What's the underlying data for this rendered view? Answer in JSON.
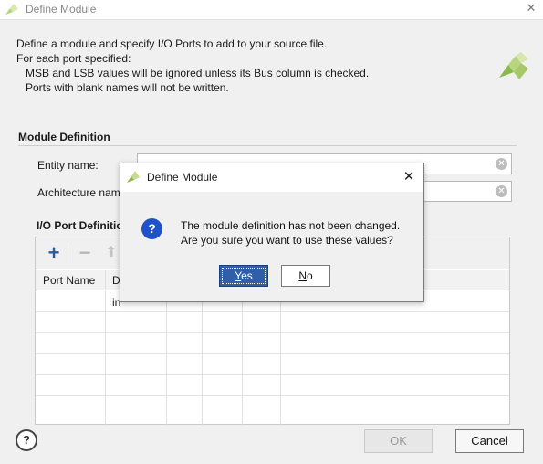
{
  "window": {
    "title": "Define Module",
    "logo_icon": "vivado-logo-icon",
    "close_icon": "close-icon"
  },
  "intro": {
    "line1": "Define a module and specify I/O Ports to add to your source file.",
    "line2": "For each port specified:",
    "line3": "MSB and LSB values will be ignored unless its Bus column is checked.",
    "line4": "Ports with blank names will not be written."
  },
  "module_definition": {
    "section_title": "Module Definition",
    "entity_label": "Entity name:",
    "entity_value": "",
    "architecture_label": "Architecture nam",
    "architecture_value": ""
  },
  "io_ports": {
    "title": "I/O Port Definitio",
    "columns": [
      "Port Name",
      "D"
    ],
    "first_row_direction": "in",
    "toolbar": {
      "add_icon": "plus-icon",
      "remove_icon": "minus-icon",
      "move_up_icon": "arrow-up-icon"
    }
  },
  "footer": {
    "help_label": "?",
    "ok_label": "OK",
    "cancel_label": "Cancel"
  },
  "modal": {
    "title": "Define Module",
    "icon": "question-icon",
    "message_line1": "The module definition has not been changed.",
    "message_line2": "Are you sure you want to use these values?",
    "yes_rest": "es",
    "yes_mnemonic": "Y",
    "no_mnemonic": "N",
    "no_rest": "o"
  },
  "colors": {
    "accent": "#2f5fa8",
    "question_icon": "#1e52c6",
    "logo_green": "#8bb84a"
  }
}
